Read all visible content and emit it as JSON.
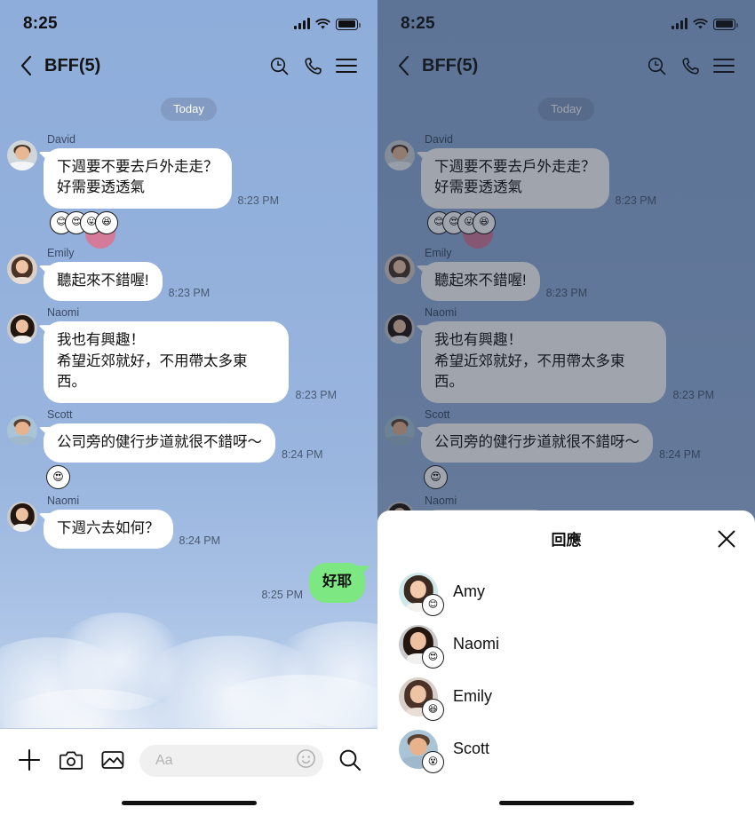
{
  "status_bar": {
    "time": "8:25",
    "signal_icon": "signal-bars-icon",
    "wifi_icon": "wifi-icon",
    "battery_icon": "battery-full-icon"
  },
  "nav": {
    "back_icon": "chevron-left-icon",
    "title": "BFF(5)",
    "search_time_icon": "search-clock-icon",
    "call_icon": "phone-icon",
    "menu_icon": "hamburger-menu-icon"
  },
  "chat": {
    "day_separator": "Today",
    "messages": [
      {
        "sender": "David",
        "avatar": "av-david",
        "text": "下週要不要去戶外走走？\n好需要透透氣",
        "time": "8:23 PM",
        "reaction_cluster": [
          "😊",
          "😍",
          "😛",
          "😆"
        ]
      },
      {
        "sender": "Emily",
        "avatar": "av-emily",
        "text": "聽起來不錯喔!",
        "time": "8:23 PM"
      },
      {
        "sender": "Naomi",
        "avatar": "av-naomi",
        "text": "我也有興趣！\n希望近郊就好，不用帶太多東西。",
        "time": "8:23 PM"
      },
      {
        "sender": "Scott",
        "avatar": "av-scott",
        "text": "公司旁的健行步道就很不錯呀～",
        "time": "8:24 PM",
        "reaction_single": "😍"
      },
      {
        "sender": "Naomi",
        "avatar": "av-naomi",
        "text": "下週六去如何？",
        "time": "8:24 PM"
      }
    ],
    "own_message": {
      "text": "好耶",
      "time": "8:25 PM",
      "bubble_color": "#7DE881"
    }
  },
  "input_bar": {
    "plus_icon": "plus-icon",
    "camera_icon": "camera-icon",
    "gallery_icon": "image-icon",
    "placeholder": "Aa",
    "emoji_icon": "smiley-face-icon",
    "search_icon": "search-icon"
  },
  "reaction_sheet": {
    "title": "回應",
    "close_icon": "close-x-icon",
    "reactors": [
      {
        "name": "Amy",
        "avatar": "av-amy",
        "reaction": "😊"
      },
      {
        "name": "Naomi",
        "avatar": "av-naomi",
        "reaction": "😍"
      },
      {
        "name": "Emily",
        "avatar": "av-emily",
        "reaction": "😆"
      },
      {
        "name": "Scott",
        "avatar": "av-scott",
        "reaction": "😵"
      }
    ]
  },
  "theme": {
    "wallpaper_top": "#8FADDA",
    "wallpaper_bottom": "#D9E5F5",
    "incoming_bubble": "#FFFFFF",
    "outgoing_bubble": "#7DE881",
    "dim_overlay": "rgba(26,38,60,0.42)",
    "sheet_bg": "#FFFFFF"
  }
}
